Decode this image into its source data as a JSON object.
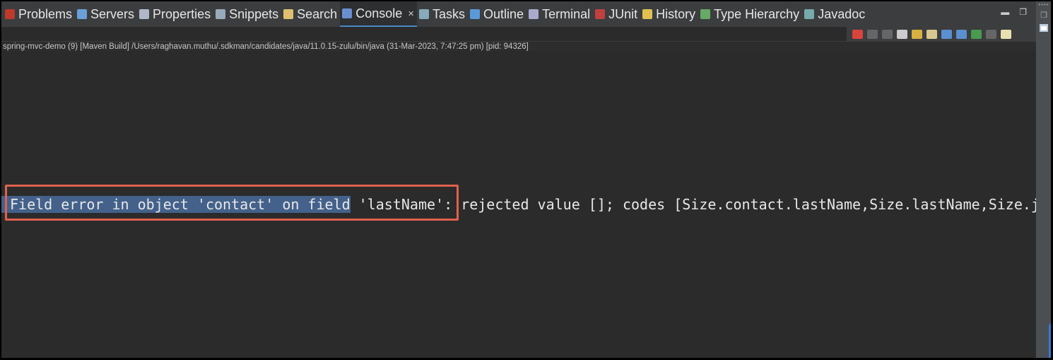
{
  "tabs": [
    {
      "label": "Problems",
      "icon": "problems-icon",
      "color": "#c0392b"
    },
    {
      "label": "Servers",
      "icon": "servers-icon",
      "color": "#6a9fd8"
    },
    {
      "label": "Properties",
      "icon": "properties-icon",
      "color": "#b0b8c8"
    },
    {
      "label": "Snippets",
      "icon": "snippets-icon",
      "color": "#9ab"
    },
    {
      "label": "Search",
      "icon": "search-icon",
      "color": "#e0c070"
    },
    {
      "label": "Console",
      "icon": "console-icon",
      "color": "#6a8fd0",
      "active": true
    },
    {
      "label": "Tasks",
      "icon": "tasks-icon",
      "color": "#8ab"
    },
    {
      "label": "Outline",
      "icon": "outline-icon",
      "color": "#5a9ad8"
    },
    {
      "label": "Terminal",
      "icon": "terminal-icon",
      "color": "#aac"
    },
    {
      "label": "JUnit",
      "icon": "junit-icon",
      "color": "#c04040"
    },
    {
      "label": "History",
      "icon": "history-icon",
      "color": "#e0c050"
    },
    {
      "label": "Type Hierarchy",
      "icon": "type-hierarchy-icon",
      "color": "#6a6"
    },
    {
      "label": "Javadoc",
      "icon": "javadoc-icon",
      "color": "#7aa"
    }
  ],
  "close_glyph": "×",
  "info_line": "spring-mvc-demo (9) [Maven Build] /Users/raghavan.muthu/.sdkman/candidates/java/11.0.15-zulu/bin/java  (31-Mar-2023, 7:47:25 pm) [pid: 94326]",
  "console": {
    "selected_text": "Field error in object 'contact' on field",
    "rest_text": " 'lastName': rejected value []; codes [Size.contact.lastName,Size.lastName,Size.j"
  },
  "colors": {
    "selection": "#43618a",
    "highlight_box": "#e0614e",
    "terminate": "#d9443c"
  }
}
